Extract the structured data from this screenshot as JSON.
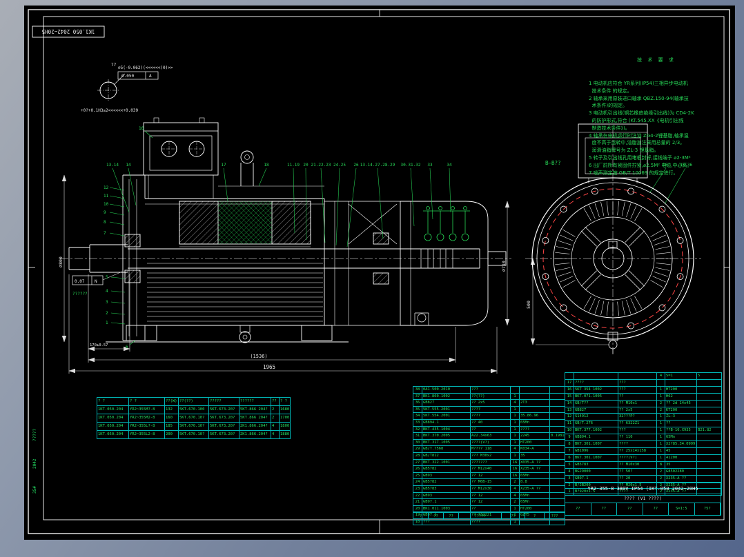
{
  "corner_label": "1K1.050 2042~20H5",
  "detail_view": {
    "flag": "77",
    "tol_line": "⌀5(-0.062)(<<<<<<(0)>>",
    "frame_tol": "0.050",
    "frame_datum": "A",
    "lower_tol": "+0?+0.1H3≥2<<<<<<+0.039"
  },
  "dims": {
    "overall": "1965",
    "inner": "(1536)",
    "shaft_ext": "170±0.57",
    "left_dia": "⌀800",
    "right_dia": "⌀710",
    "front_height": "500",
    "runout_val": "0.07",
    "runout_datum": "N",
    "under_note": "??????"
  },
  "balloons": {
    "top": [
      "13.14",
      "14",
      "17",
      "18",
      "11.19",
      "20",
      "21.22.23",
      "24.25",
      "26",
      "13.14.27.28.29",
      "30.31.32",
      "33",
      "34"
    ],
    "box": "16",
    "left_upper": [
      "12",
      "11",
      "10",
      "9",
      "8",
      "7"
    ],
    "left_lower": [
      "5",
      "4",
      "3",
      "2",
      "1"
    ],
    "bottom": "6",
    "front": [
      "16",
      "35.36"
    ]
  },
  "section_label": "B—B??",
  "notes": {
    "title": "技 术 要 求",
    "lines": [
      "1 电动机应符合 YR系列(IP54)三相异步电动机",
      "  技术条件 的规定。",
      "2 轴承采用原装进口轴承 QBZ.150-94(轴承技",
      "  术条件)的规定。",
      "3 电动机引出线(铜芯橡皮绝缘引出线)为 CD4-2K",
      "  的防护形式,符合 (KT.545.XX《电机引出线",
      "  制造技术条件》)。",
      "4 轴承在电机运行时注油 ZG4-2锂基脂,轴承温",
      "  度不高于运转中,油脂加注采用总量的 2/3。",
      "  润滑油脂牌号为 ZL-3 锂基脂。",
      "5 转子及引出线孔用堵板封好,接线端子 ⌀2-3M²",
      "6 出厂前所有紧固件拧紧,⌀2.5M² 电缆,中心高。",
      "7 噪声测定按 GB/T 10069 的规定进行。"
    ]
  },
  "spec_table": {
    "headers": [
      "? ?",
      "? ?",
      "??(W)",
      "??(??)",
      "?????",
      "??????",
      "??",
      "? ?"
    ],
    "rows": [
      [
        "1KT.050.204",
        "YR2~355M?-8",
        "132",
        "5KT.670.100",
        "5KT.673.20?",
        "5KT.866 204?",
        "2",
        "1680"
      ],
      [
        "1KT.050.204",
        "YR2~355M2-8",
        "160",
        "5KT.670.10?",
        "5KT.673.20?",
        "5KT.866 204?",
        "2",
        "1700"
      ],
      [
        "1KT.050.204",
        "YR2~355L?-8",
        "185",
        "5KT.670.10?",
        "5KT.673.20?",
        "2K1.866.204?",
        "4",
        "1800"
      ],
      [
        "1KT.050.204",
        "YR2~355L2-8",
        "200",
        "5KT.670.10?",
        "5KT.673.20?",
        "2K1.866.204?",
        "4",
        "1880"
      ]
    ]
  },
  "bom_left": {
    "rows": [
      [
        "38",
        "0A1.500.2010",
        "???",
        "",
        "",
        ""
      ],
      [
        "37",
        "BK1.860.1002",
        "??(??)",
        "1",
        "",
        ""
      ],
      [
        "36",
        "GB827",
        "?? 2x5",
        "4",
        "2T3",
        ""
      ],
      [
        "35",
        "5KT.555.2001",
        "????",
        "1",
        "",
        ""
      ],
      [
        "34",
        "5KT.554.2001",
        "????",
        "1",
        "35.86.96",
        ""
      ],
      [
        "33",
        "GB894.1",
        "?? 40",
        "1",
        "65Mn",
        ""
      ],
      [
        "32",
        "BKT.435.1004",
        "??",
        "1",
        "????",
        ""
      ],
      [
        "31",
        "BKT.370.2005",
        "A22.34x63",
        "1",
        "2245",
        "0.19816"
      ],
      [
        "30",
        "BKT.317.1005",
        "????(V?)",
        "1",
        "HT200",
        ""
      ],
      [
        "29",
        "GB/T.7568",
        "M???? 118",
        "4",
        "K034-A",
        ""
      ],
      [
        "28",
        "GB/T812",
        "??? M30x2",
        "1",
        "35",
        ""
      ],
      [
        "27",
        "BKT.322.1001",
        "???????",
        "16",
        "X035-A ??",
        ""
      ],
      [
        "26",
        "GB5782",
        "?? M12x40",
        "16",
        "X235-A ??",
        ""
      ],
      [
        "25",
        "GB93",
        "?? 12",
        "16",
        "65Mn",
        ""
      ],
      [
        "24",
        "GB5782",
        "?? M6B-15",
        "2",
        "8.8",
        ""
      ],
      [
        "23",
        "GB5783",
        "?? M12x30",
        "4",
        "X235-A ??",
        ""
      ],
      [
        "22",
        "GB93",
        "?? 12",
        "4",
        "65Mn",
        ""
      ],
      [
        "21",
        "GB97.1",
        "?? 12",
        "2",
        "65Mn",
        ""
      ],
      [
        "20",
        "BK1.011.1003",
        "??",
        "1",
        "HT200",
        ""
      ],
      [
        "19",
        "GB97.1",
        "?? 732221",
        "1",
        "GZT5",
        ""
      ],
      [
        "18",
        "???",
        "????",
        "1",
        "",
        ""
      ]
    ]
  },
  "bom_right": {
    "header": [
      "",
      "",
      "",
      "4",
      "S=1",
      "5"
    ],
    "rows": [
      [
        "17",
        "????",
        "???",
        "",
        "",
        ""
      ],
      [
        "16",
        "5KT 354 1002",
        "???",
        "1",
        "HT200",
        ""
      ],
      [
        "15",
        "BKT.071.1005",
        "??",
        "1",
        "H62",
        ""
      ],
      [
        "14",
        "GB/T??",
        "?? M10x1",
        "2",
        "?? 2d 14x45",
        ""
      ],
      [
        "13",
        "GB827",
        "?? 2x5",
        "2",
        "KT200",
        ""
      ],
      [
        "12",
        "S14912",
        "32???P?",
        "1",
        "ZL—3",
        ""
      ],
      [
        "11",
        "GB/T.276",
        "?? 6322Z1",
        "1",
        "??",
        ""
      ],
      [
        "10",
        "BKT.377.1002",
        "???",
        "1",
        "??B-16.X935",
        "B21.82"
      ],
      [
        "9",
        "GB894.1",
        "?? 110",
        "1",
        "65Mn",
        ""
      ],
      [
        "8",
        "BKT.301.1007",
        "????",
        "1",
        "X2?85.34.0999",
        ""
      ],
      [
        "7",
        "GB1096",
        "?? 25x14x158",
        "1",
        "45",
        ""
      ],
      [
        "6",
        "BKT.301.1007",
        "????(V?)",
        "1",
        "41200",
        ""
      ],
      [
        "5",
        "GB5783",
        "?? M10x30",
        "8",
        "35",
        ""
      ],
      [
        "4",
        "BG29000",
        "?? 50?",
        "2",
        "G8502280",
        ""
      ],
      [
        "3",
        "GB97.1",
        "?? 20",
        "2",
        "X235—A ??",
        ""
      ],
      [
        "2",
        "B/2B200",
        "?? M20x1.5",
        "2",
        "X235—A ??",
        ""
      ],
      [
        "1",
        "B?920x1.5",
        "????",
        "2",
        "X235—A ??",
        ""
      ]
    ]
  },
  "title_block": {
    "model_line": "YR2-355-8 380V IP54 (IKT.050 2042~20H5",
    "name_line": "???? (V1 ????)",
    "cells": [
      "??",
      "??",
      "??",
      "??",
      "S=1:5",
      "?5?"
    ]
  },
  "sign_strip": [
    "?",
    "??",
    "??",
    "?????",
    "??",
    "?",
    "???"
  ],
  "margin_labels": [
    "?????",
    "2042",
    "35#"
  ]
}
